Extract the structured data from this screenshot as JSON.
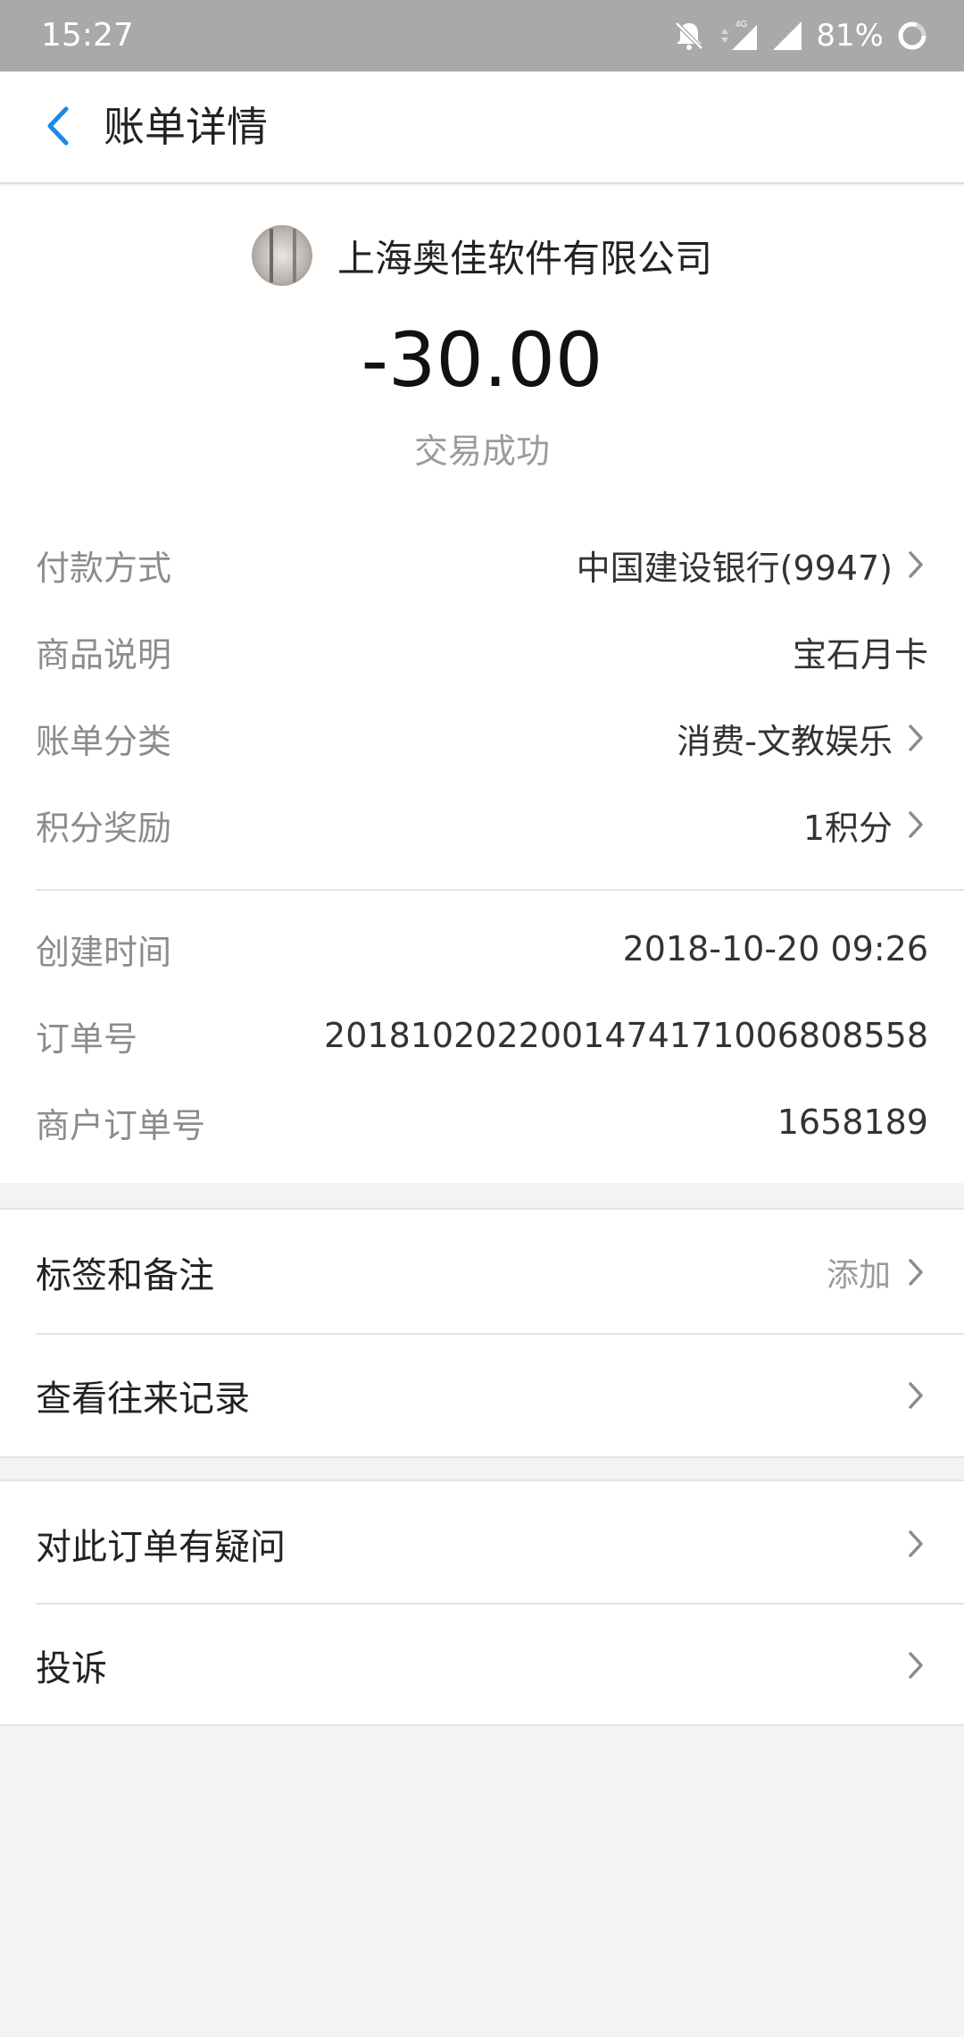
{
  "status_bar": {
    "time": "15:27",
    "network": "4G",
    "battery": "81%"
  },
  "header": {
    "back_icon": "chevron-left-icon",
    "title": "账单详情",
    "accent_color": "#1e88e5"
  },
  "summary": {
    "merchant_name": "上海奥佳软件有限公司",
    "amount": "-30.00",
    "status": "交易成功"
  },
  "details": [
    {
      "label": "付款方式",
      "value": "中国建设银行(9947)",
      "has_arrow": true
    },
    {
      "label": "商品说明",
      "value": "宝石月卡",
      "has_arrow": false
    },
    {
      "label": "账单分类",
      "value": "消费-文教娱乐",
      "has_arrow": true
    },
    {
      "label": "积分奖励",
      "value": "1积分",
      "has_arrow": true
    }
  ],
  "order_info": [
    {
      "label": "创建时间",
      "value": "2018-10-20 09:26"
    },
    {
      "label": "订单号",
      "value": "2018102022001474171006808558"
    },
    {
      "label": "商户订单号",
      "value": "1658189"
    }
  ],
  "actions_group1": [
    {
      "label": "标签和备注",
      "hint": "添加"
    },
    {
      "label": "查看往来记录",
      "hint": ""
    }
  ],
  "actions_group2": [
    {
      "label": "对此订单有疑问"
    },
    {
      "label": "投诉"
    }
  ]
}
